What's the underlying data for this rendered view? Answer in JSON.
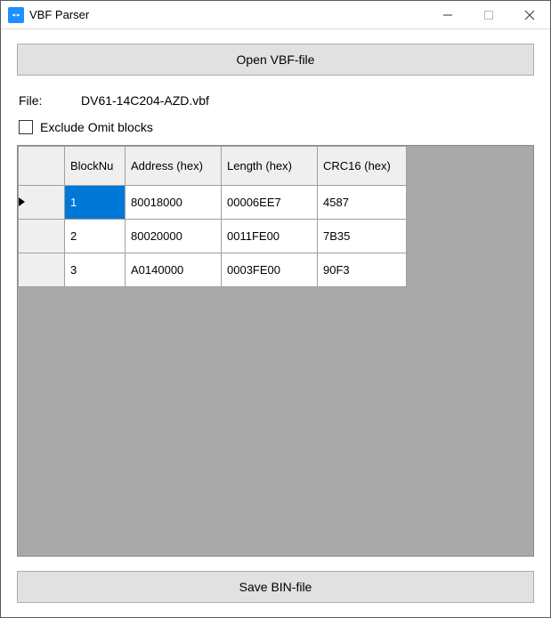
{
  "window": {
    "title": "VBF Parser"
  },
  "buttons": {
    "open": "Open VBF-file",
    "save": "Save BIN-file"
  },
  "file": {
    "label": "File:",
    "value": "DV61-14C204-AZD.vbf"
  },
  "exclude": {
    "label": "Exclude Omit blocks",
    "checked": false
  },
  "grid": {
    "headers": {
      "blocknum": "BlockNu",
      "address": "Address (hex)",
      "length": "Length (hex)",
      "crc16": "CRC16 (hex)"
    },
    "rows": [
      {
        "num": "1",
        "address": "80018000",
        "length": "00006EE7",
        "crc": "4587",
        "selected": true
      },
      {
        "num": "2",
        "address": "80020000",
        "length": "0011FE00",
        "crc": "7B35",
        "selected": false
      },
      {
        "num": "3",
        "address": "A0140000",
        "length": "0003FE00",
        "crc": "90F3",
        "selected": false
      }
    ]
  }
}
